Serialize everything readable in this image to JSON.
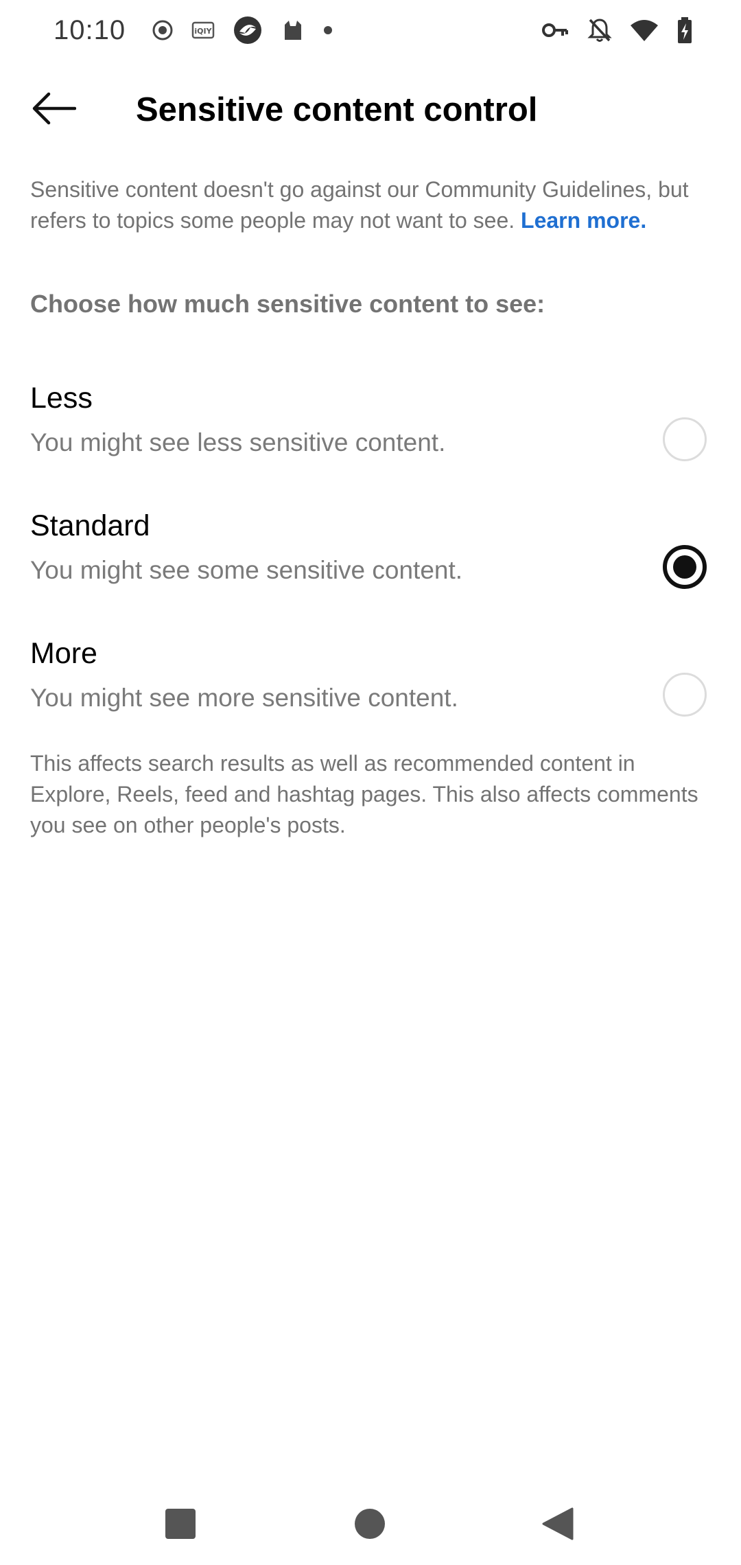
{
  "status_bar": {
    "time": "10:10"
  },
  "app_bar": {
    "title": "Sensitive content control"
  },
  "intro": {
    "text": "Sensitive content doesn't go against our Community Guidelines, but refers to topics some people may not want to see.",
    "link": "Learn more."
  },
  "section": {
    "heading": "Choose how much sensitive content to see:"
  },
  "options": [
    {
      "title": "Less",
      "description": "You might see less sensitive content.",
      "selected": false
    },
    {
      "title": "Standard",
      "description": "You might see some sensitive content.",
      "selected": true
    },
    {
      "title": "More",
      "description": "You might see more sensitive content.",
      "selected": false
    }
  ],
  "footnote": "This affects search results as well as recommended content in Explore, Reels, feed and hashtag pages. This also affects comments you see on other people's posts.",
  "icons": {
    "status_left": [
      "record-icon",
      "iqiyi-icon",
      "app-swirl-icon",
      "cat-icon",
      "dot-icon"
    ],
    "status_right": [
      "vpn-key-icon",
      "notifications-off-icon",
      "wifi-icon",
      "battery-charging-icon"
    ],
    "nav": [
      "recents-square-icon",
      "home-circle-icon",
      "back-triangle-icon"
    ]
  },
  "colors": {
    "link": "#1f6fd1",
    "secondary_text": "#737373",
    "radio_selected": "#111111"
  }
}
